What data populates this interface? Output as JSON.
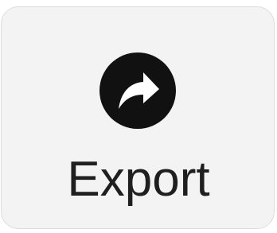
{
  "export_button": {
    "label": "Export",
    "icon": "share-arrow-circle-icon"
  },
  "colors": {
    "tile_background": "#f3f3f3",
    "tile_border": "#dcdcdc",
    "icon_circle": "#111111",
    "icon_arrow": "#ffffff",
    "label_text": "#1f1f1f"
  }
}
